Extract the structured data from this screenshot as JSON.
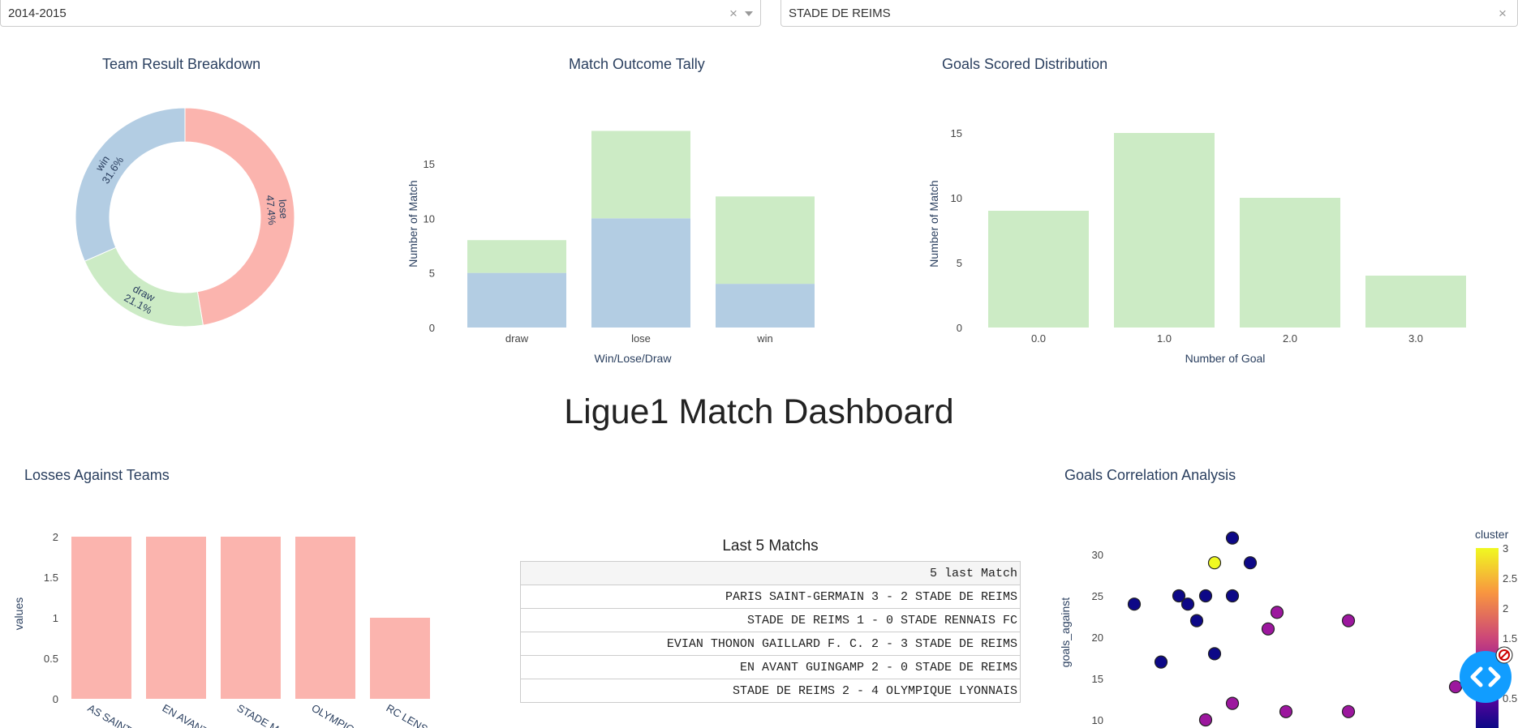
{
  "filters": {
    "season": {
      "value": "2014-2015",
      "clear": "×"
    },
    "team": {
      "value": "STADE DE REIMS",
      "clear": "×"
    }
  },
  "dashboard_title": "Ligue1 Match Dashboard",
  "charts": {
    "donut": {
      "title": "Team Result Breakdown"
    },
    "outcome": {
      "title": "Match Outcome Tally"
    },
    "goals": {
      "title": "Goals Scored Distribution"
    },
    "losses": {
      "title": "Losses Against Teams"
    },
    "scatter": {
      "title": "Goals Correlation Analysis",
      "colorbar_title": "cluster"
    }
  },
  "last5": {
    "title": "Last 5 Matchs",
    "header": "5 last Match",
    "rows": [
      "PARIS SAINT-GERMAIN 3 - 2 STADE DE REIMS",
      "STADE DE REIMS 1 - 0 STADE RENNAIS FC",
      "EVIAN THONON GAILLARD F. C. 2 - 3 STADE DE REIMS",
      "EN AVANT GUINGAMP 2 - 0 STADE DE REIMS",
      "STADE DE REIMS 2 - 4 OLYMPIQUE LYONNAIS"
    ]
  },
  "colors": {
    "lose": "#fbb4ae",
    "win": "#b3cde3",
    "draw": "#ccebc5",
    "scatter_dark": "#0d0887",
    "scatter_mid": "#9c179e",
    "scatter_yellow": "#f0f921",
    "fab": "#119dff"
  },
  "icons": {
    "nav": "code-brackets-icon",
    "notice": "no-entry-icon"
  },
  "chart_data": [
    {
      "type": "pie",
      "title": "Team Result Breakdown",
      "labels": [
        "lose",
        "draw",
        "win"
      ],
      "values": [
        47.4,
        21.1,
        31.6
      ],
      "text": [
        "47.4%",
        "21.1%",
        "31.6%"
      ],
      "hole": true
    },
    {
      "type": "bar",
      "title": "Match Outcome Tally",
      "xlabel": "Win/Lose/Draw",
      "ylabel": "Number of Match",
      "categories": [
        "draw",
        "lose",
        "win"
      ],
      "stacked": true,
      "series": [
        {
          "values": [
            5,
            10,
            4
          ]
        },
        {
          "values": [
            3,
            8,
            8
          ]
        }
      ],
      "yticks": [
        "0",
        "5",
        "10",
        "15"
      ],
      "ylim": [
        0,
        19
      ]
    },
    {
      "type": "bar",
      "title": "Goals Scored Distribution",
      "xlabel": "Number of Goal",
      "ylabel": "Number of Match",
      "categories": [
        "0.0",
        "1.0",
        "2.0",
        "3.0"
      ],
      "values": [
        9,
        15,
        10,
        4
      ],
      "yticks": [
        "0",
        "5",
        "10",
        "15"
      ],
      "ylim": [
        0,
        16
      ]
    },
    {
      "type": "bar",
      "title": "Losses Against Teams",
      "ylabel": "values",
      "categories": [
        "AS SAINT...",
        "EN AVANT...",
        "STADE M...",
        "OLYMPIQ...",
        "RC LENS"
      ],
      "values": [
        2,
        2,
        2,
        2,
        1
      ],
      "yticks": [
        "0",
        "0.5",
        "1",
        "1.5",
        "2"
      ],
      "ylim": [
        0,
        2.1
      ]
    },
    {
      "type": "scatter",
      "title": "Goals Correlation Analysis",
      "ylabel": "goals_against",
      "yticks": [
        "10",
        "15",
        "20",
        "25",
        "30"
      ],
      "colorbar_ticks": [
        "3",
        "2.5",
        "2",
        "1.5",
        "1",
        "0.5"
      ],
      "points": [
        {
          "x": 1,
          "y": 24,
          "cluster": 0
        },
        {
          "x": 2.5,
          "y": 17,
          "cluster": 0
        },
        {
          "x": 3.5,
          "y": 25,
          "cluster": 0
        },
        {
          "x": 4,
          "y": 24,
          "cluster": 0
        },
        {
          "x": 4.5,
          "y": 22,
          "cluster": 0
        },
        {
          "x": 5,
          "y": 25,
          "cluster": 0
        },
        {
          "x": 5.5,
          "y": 18,
          "cluster": 0
        },
        {
          "x": 5.5,
          "y": 29,
          "cluster": 3
        },
        {
          "x": 6.5,
          "y": 32,
          "cluster": 0
        },
        {
          "x": 6.5,
          "y": 25,
          "cluster": 0
        },
        {
          "x": 7.5,
          "y": 29,
          "cluster": 0
        },
        {
          "x": 8.5,
          "y": 21,
          "cluster": 1
        },
        {
          "x": 9,
          "y": 23,
          "cluster": 1
        },
        {
          "x": 13,
          "y": 22,
          "cluster": 1
        },
        {
          "x": 19,
          "y": 14,
          "cluster": 1
        },
        {
          "x": 5,
          "y": 10,
          "cluster": 1
        },
        {
          "x": 6.5,
          "y": 12,
          "cluster": 1
        },
        {
          "x": 9.5,
          "y": 11,
          "cluster": 1
        },
        {
          "x": 13,
          "y": 11,
          "cluster": 1
        }
      ]
    }
  ]
}
